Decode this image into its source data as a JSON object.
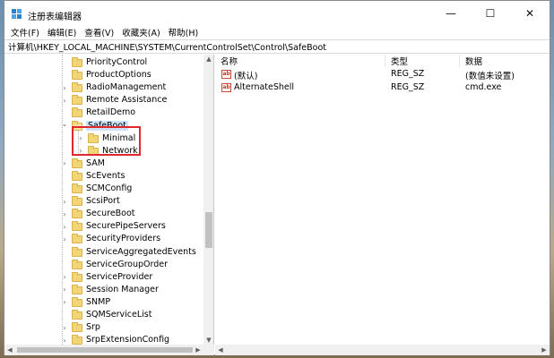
{
  "window": {
    "title": "注册表编辑器",
    "controls": {
      "minimize": "—",
      "maximize": "☐",
      "close": "✕"
    }
  },
  "menu": [
    {
      "label": "文件(F)"
    },
    {
      "label": "编辑(E)"
    },
    {
      "label": "查看(V)"
    },
    {
      "label": "收藏夹(A)"
    },
    {
      "label": "帮助(H)"
    }
  ],
  "address": "计算机\\HKEY_LOCAL_MACHINE\\SYSTEM\\CurrentControlSet\\Control\\SafeBoot",
  "tree": [
    {
      "label": "PriorityControl",
      "level": 0,
      "expander": ""
    },
    {
      "label": "ProductOptions",
      "level": 0,
      "expander": ""
    },
    {
      "label": "RadioManagement",
      "level": 0,
      "expander": ">"
    },
    {
      "label": "Remote Assistance",
      "level": 0,
      "expander": ">"
    },
    {
      "label": "RetailDemo",
      "level": 0,
      "expander": ""
    },
    {
      "label": "SafeBoot",
      "level": 0,
      "expander": "v",
      "selected": true,
      "open": true
    },
    {
      "label": "Minimal",
      "level": 1,
      "expander": ">"
    },
    {
      "label": "Network",
      "level": 1,
      "expander": ">"
    },
    {
      "label": "SAM",
      "level": 0,
      "expander": ">"
    },
    {
      "label": "ScEvents",
      "level": 0,
      "expander": ""
    },
    {
      "label": "SCMConfig",
      "level": 0,
      "expander": ""
    },
    {
      "label": "ScsiPort",
      "level": 0,
      "expander": ">"
    },
    {
      "label": "SecureBoot",
      "level": 0,
      "expander": ">"
    },
    {
      "label": "SecurePipeServers",
      "level": 0,
      "expander": ">"
    },
    {
      "label": "SecurityProviders",
      "level": 0,
      "expander": ">"
    },
    {
      "label": "ServiceAggregatedEvents",
      "level": 0,
      "expander": ""
    },
    {
      "label": "ServiceGroupOrder",
      "level": 0,
      "expander": ""
    },
    {
      "label": "ServiceProvider",
      "level": 0,
      "expander": ">"
    },
    {
      "label": "Session Manager",
      "level": 0,
      "expander": ">"
    },
    {
      "label": "SNMP",
      "level": 0,
      "expander": ">"
    },
    {
      "label": "SQMServiceList",
      "level": 0,
      "expander": ""
    },
    {
      "label": "Srp",
      "level": 0,
      "expander": ">"
    },
    {
      "label": "SrpExtensionConfig",
      "level": 0,
      "expander": ">"
    }
  ],
  "list": {
    "columns": [
      "名称",
      "类型",
      "数据"
    ],
    "rows": [
      {
        "name": "(默认)",
        "type": "REG_SZ",
        "data": "(数值未设置)"
      },
      {
        "name": "AlternateShell",
        "type": "REG_SZ",
        "data": "cmd.exe"
      }
    ]
  },
  "colors": {
    "highlight_box": "#e0282e",
    "selection": "#cce4f7",
    "folder": "#f2d577"
  }
}
